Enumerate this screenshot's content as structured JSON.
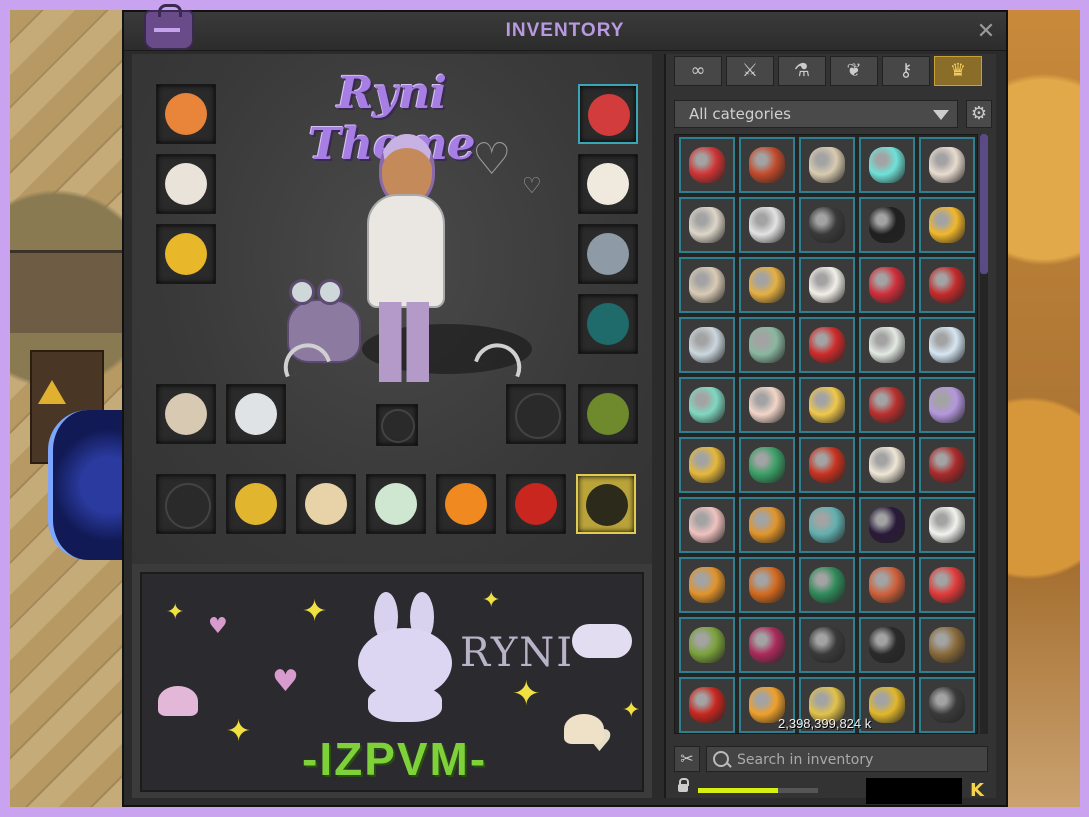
{
  "window": {
    "title": "INVENTORY"
  },
  "banner": {
    "theme_title": "Ryni Theme",
    "name": "RYNI",
    "tag": "-IZPVM-"
  },
  "equipment": {
    "left_slots": [
      {
        "name": "amulet-slot",
        "color": "#e9843b"
      },
      {
        "name": "hat-slot",
        "color": "#e9e3da"
      },
      {
        "name": "ring-slot",
        "color": "#e8b82a"
      }
    ],
    "right_slots": [
      {
        "name": "belt-slot",
        "color": "#d23c3c",
        "selected": true
      },
      {
        "name": "pet-slot",
        "color": "#efe9de"
      },
      {
        "name": "ring-right-slot",
        "color": "#8e9aa6"
      },
      {
        "name": "boots-slot",
        "color": "#1f6a6a"
      }
    ],
    "mid_slots": [
      {
        "name": "weapon-slot",
        "color": "#d8c9b2"
      },
      {
        "name": "shield-slot",
        "color": "#dfe3e6"
      },
      {
        "name": "companion-slot",
        "color": "#555",
        "empty": true
      },
      {
        "name": "mount-slot",
        "color": "#6f8a2c"
      }
    ],
    "bottom_slots": [
      {
        "name": "dofus-empty-slot",
        "color": "#555",
        "empty": true
      },
      {
        "name": "dofus-slot-1",
        "color": "#e2b52e"
      },
      {
        "name": "dofus-slot-2",
        "color": "#e8d2a8"
      },
      {
        "name": "dofus-slot-3",
        "color": "#cfe7d0"
      },
      {
        "name": "dofus-slot-4",
        "color": "#f08a20"
      },
      {
        "name": "dofus-slot-5",
        "color": "#c8261e"
      },
      {
        "name": "costume-slot",
        "color": "#2c2a1a",
        "gold": true
      }
    ]
  },
  "inventory": {
    "category_tabs": [
      {
        "icon": "infinity-icon",
        "glyph": "∞",
        "active": false
      },
      {
        "icon": "sword-icon",
        "glyph": "⚔",
        "active": false
      },
      {
        "icon": "potion-icon",
        "glyph": "⚗",
        "active": false
      },
      {
        "icon": "plant-icon",
        "glyph": "❦",
        "active": false
      },
      {
        "icon": "key-icon",
        "glyph": "⚷",
        "active": false
      },
      {
        "icon": "crown-icon",
        "glyph": "♛",
        "active": true
      }
    ],
    "category_select": "All categories",
    "search_placeholder": "Search in inventory",
    "kamas": "2,398,399,824 k",
    "weight_fraction": 0.67,
    "currency_glyph": "K",
    "item_colors": [
      "#d03434",
      "#c24a2a",
      "#d8cbb0",
      "#6fe2d8",
      "#e9dcd0",
      "#ddd6c8",
      "#e3e3e3",
      "#3a3a3a",
      "#202020",
      "#f2b72b",
      "#d9cbb5",
      "#e6b042",
      "#f2efe8",
      "#cf2e3a",
      "#c42b2b",
      "#cbd7de",
      "#8ab7a0",
      "#cf2b2b",
      "#e3e9e3",
      "#d6e6f2",
      "#7fd8c0",
      "#f2d6c8",
      "#f0c84a",
      "#b9302e",
      "#b497dd",
      "#e6b83a",
      "#3a9f66",
      "#c8321e",
      "#efe6d6",
      "#aa2a2a",
      "#f0c2bf",
      "#e2952a",
      "#62b0b0",
      "#2a1a3a",
      "#f2f2ee",
      "#e2932a",
      "#d36a1e",
      "#2f8a5a",
      "#d0603a",
      "#e23a3a",
      "#7aa23a",
      "#aa2a5a",
      "#3a3a3a",
      "#2a2a2a",
      "#8a6a3a",
      "#c8261e",
      "#f0a02a",
      "#e2c24a",
      "#e2b72a",
      "#3a3a3a"
    ]
  }
}
